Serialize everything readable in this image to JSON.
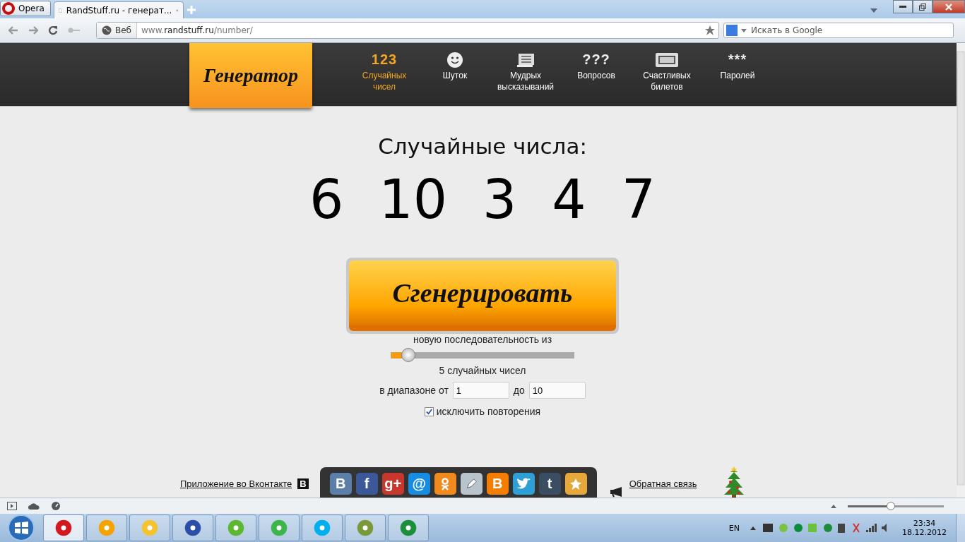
{
  "browser": {
    "menu_label": "Opera",
    "tab": {
      "title": "RandStuff.ru - генерат...",
      "selected": true
    },
    "address": {
      "badge": "Веб",
      "url_prefix": "www.",
      "url_domain": "randstuff.ru",
      "url_path": "/number/"
    },
    "search": {
      "placeholder": "Искать в Google"
    }
  },
  "nav": {
    "logo": "Генератор",
    "items": [
      {
        "kind": "text",
        "glyph": "123",
        "label": "Случайных\nчисел",
        "selected": true
      },
      {
        "kind": "smile",
        "label": "Шуток",
        "selected": false
      },
      {
        "kind": "scroll",
        "label": "Мудрых\nвысказываний",
        "selected": false
      },
      {
        "kind": "text",
        "glyph": "???",
        "label": "Вопросов",
        "selected": false
      },
      {
        "kind": "ticket",
        "label": "Счастливых\nбилетов",
        "selected": false
      },
      {
        "kind": "text",
        "glyph": "***",
        "label": "Паролей",
        "selected": false
      }
    ]
  },
  "main": {
    "heading": "Случайные числа:",
    "numbers": [
      "6",
      "10",
      "3",
      "4",
      "7"
    ],
    "button": "Сгенерировать",
    "slider": {
      "caption": "новую последовательность из",
      "level": 0.08
    },
    "count_text": "5 случайных чисел",
    "range": {
      "label": "в диапазоне от",
      "from": "1",
      "to_label": "до",
      "to": "10"
    },
    "exclude": {
      "label": "исключить повторения",
      "checked": true
    }
  },
  "footer": {
    "vk_link": "Приложение во Вконтакте",
    "vk_badge": "В",
    "share": [
      {
        "kind": "letter",
        "glyph": "B",
        "color": "#5b7fa6"
      },
      {
        "kind": "letter",
        "glyph": "f",
        "color": "#3b5998"
      },
      {
        "kind": "letter",
        "glyph": "g+",
        "color": "#c8372d"
      },
      {
        "kind": "letter",
        "glyph": "@",
        "color": "#168de2"
      },
      {
        "kind": "ok",
        "color": "#f08a1d"
      },
      {
        "kind": "pen",
        "color": "#b9c3cc"
      },
      {
        "kind": "letter",
        "glyph": "B",
        "color": "#f57d00"
      },
      {
        "kind": "bird",
        "color": "#2f9fd8"
      },
      {
        "kind": "letter",
        "glyph": "t",
        "color": "#3b4d63"
      },
      {
        "kind": "star",
        "color": "#e6a83a"
      }
    ],
    "feedback_link": "Обратная связь"
  },
  "status_bar": {
    "zoom": {
      "level": 0.45
    }
  },
  "taskbar": {
    "apps": [
      {
        "color": "#d3181e",
        "selected": true
      },
      {
        "color": "#f5a300",
        "selected": false
      },
      {
        "color": "#f4c430",
        "selected": false
      },
      {
        "color": "#2b4fa8",
        "selected": false
      },
      {
        "color": "#5cb82e",
        "selected": false
      },
      {
        "color": "#3cb54a",
        "selected": false
      },
      {
        "color": "#00aff0",
        "selected": false
      },
      {
        "color": "#7a9a3a",
        "selected": false
      },
      {
        "color": "#1b8f3a",
        "selected": false
      }
    ],
    "language": "EN",
    "time": "23:34",
    "date": "18.12.2012"
  }
}
